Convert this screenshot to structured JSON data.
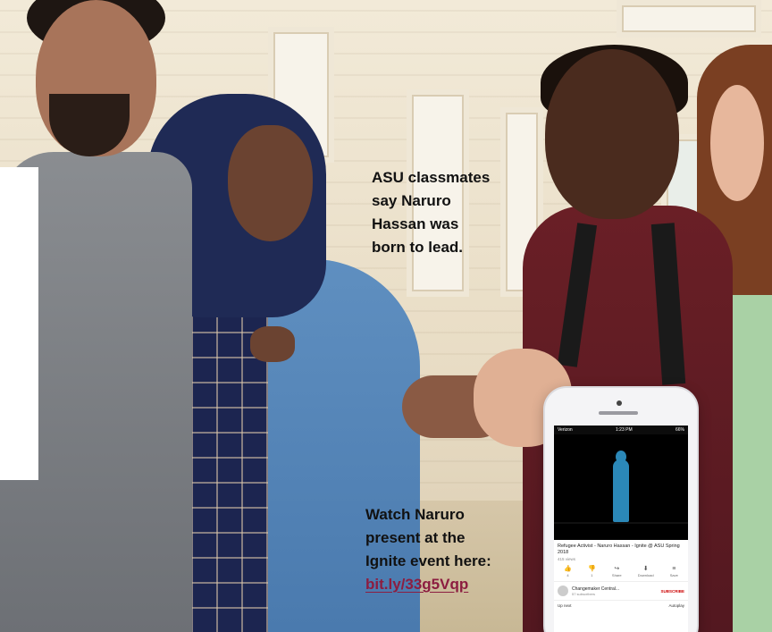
{
  "caption_top": {
    "line1": "ASU classmates",
    "line2": "say Naruro",
    "line3": "Hassan was",
    "line4": "born to lead."
  },
  "caption_bottom": {
    "line1": "Watch Naruro",
    "line2": "present at the",
    "line3": "Ignite event here:",
    "link": "bit.ly/33g5Vqp"
  },
  "phone": {
    "status_left": "Verizon",
    "status_time": "1:23 PM",
    "status_right": "66%",
    "video_title": "Refugee Activist - Naruro Hassan - Ignite @ ASU Spring 2018",
    "video_views": "415 views",
    "actions": [
      {
        "icon": "thumbs-up-icon",
        "glyph": "👍",
        "label": "4"
      },
      {
        "icon": "thumbs-down-icon",
        "glyph": "👎",
        "label": "1"
      },
      {
        "icon": "share-icon",
        "glyph": "↪",
        "label": "Share"
      },
      {
        "icon": "download-icon",
        "glyph": "⬇",
        "label": "Download"
      },
      {
        "icon": "save-icon",
        "glyph": "≡",
        "label": "Save"
      }
    ],
    "channel_name": "Changemaker Central...",
    "channel_subs": "57 subscribers",
    "subscribe_label": "SUBSCRIBE",
    "up_next": "Up next",
    "autoplay": "Autoplay"
  },
  "colors": {
    "link": "#8c1d40",
    "caption": "#111111"
  }
}
